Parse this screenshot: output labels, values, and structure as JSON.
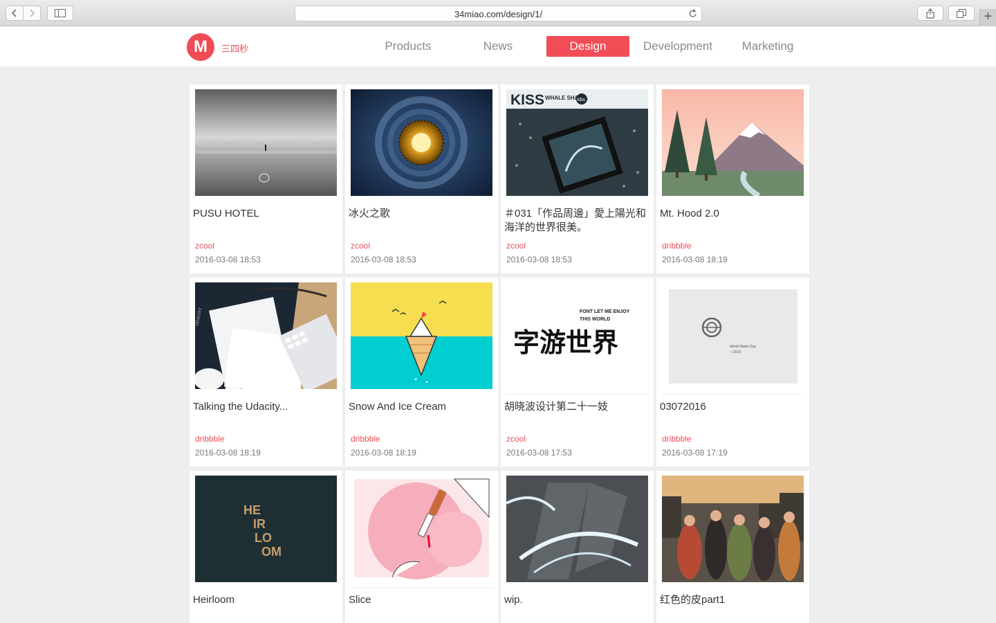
{
  "browser": {
    "url": "34miao.com/design/1/",
    "icons": [
      "back-icon",
      "forward-icon",
      "sidebar-icon",
      "reload-icon",
      "share-icon",
      "tabs-icon",
      "new-tab-icon"
    ]
  },
  "header": {
    "logo_letter": "M",
    "logo_text": "三四秒",
    "brand_color": "#ef4b55",
    "nav": [
      {
        "label": "Products"
      },
      {
        "label": "News"
      },
      {
        "label": "Design",
        "active": true
      },
      {
        "label": "Development"
      },
      {
        "label": "Marketing"
      }
    ]
  },
  "cards": [
    {
      "title": "PUSU HOTEL",
      "source": "zcool",
      "date": "2016-03-08 18:53",
      "thumb": "foggy-beach-photo"
    },
    {
      "title": "冰火之歌",
      "source": "zcool",
      "date": "2016-03-08 18:53",
      "thumb": "spiral-stairwell-photo"
    },
    {
      "title": "＃031「作品周邊」愛上陽光和海洋的世界很美。",
      "source": "zcool",
      "date": "2016-03-08 18:53",
      "thumb": "whale-shark-artwork"
    },
    {
      "title": "Mt. Hood 2.0",
      "source": "dribbble",
      "date": "2016-03-08 18:19",
      "thumb": "mountain-illustration"
    },
    {
      "title": "Talking the Udacity...",
      "source": "dribbble",
      "date": "2016-03-08 18:19",
      "thumb": "udacity-stationery"
    },
    {
      "title": "Snow And Ice Cream",
      "source": "dribbble",
      "date": "2016-03-08 18:19",
      "thumb": "iceberg-cone-illustration"
    },
    {
      "title": "胡晓波设计第二十一妓",
      "source": "zcool",
      "date": "2016-03-08 17:53",
      "thumb": "chinese-typography"
    },
    {
      "title": "03072016",
      "source": "dribbble",
      "date": "2016-03-08 17:19",
      "thumb": "water-day-card"
    },
    {
      "title": "Heirloom",
      "source": "",
      "date": "",
      "thumb": "heirloom-logo"
    },
    {
      "title": "Slice",
      "source": "",
      "date": "",
      "thumb": "slice-illustration"
    },
    {
      "title": "wip.",
      "source": "",
      "date": "",
      "thumb": "glass-letter-3d"
    },
    {
      "title": "红色的皮part1",
      "source": "",
      "date": "",
      "thumb": "crowd-illustration"
    }
  ],
  "thumb_texts": {
    "whale_shark_header": "KISS",
    "whale_shark_sub": "WHALE SHARK.",
    "whale_shark_badge": "kbs",
    "typo_top": "FONT  LET ME ENJOY",
    "typo_top2": "THIS WORLD",
    "typo_main": "字游世界",
    "water_day": "World Water Day",
    "water_year": "—2016",
    "udacity": "UDACITY",
    "heirloom": [
      "HE",
      "IR",
      "LO",
      "OM"
    ]
  }
}
